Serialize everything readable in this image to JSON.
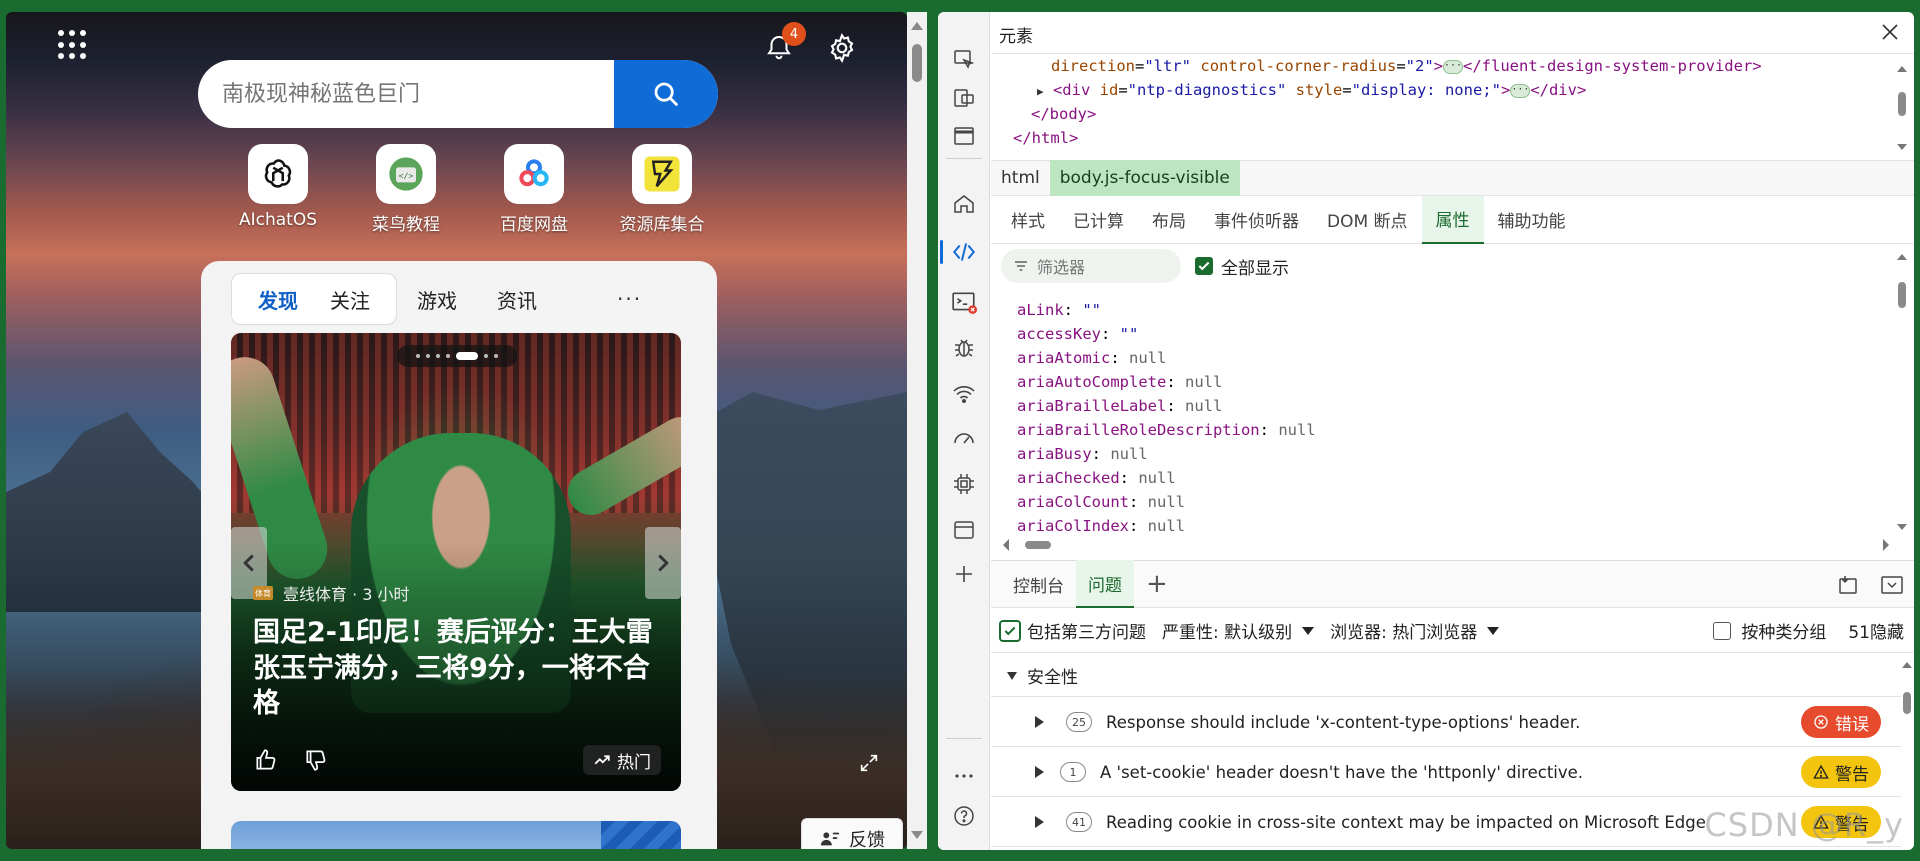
{
  "ntp": {
    "notification_count": "4",
    "search": {
      "placeholder": "南极现神秘蓝色巨门"
    },
    "quick_links": [
      {
        "label": "AIchatOS",
        "icon": "openai-icon"
      },
      {
        "label": "菜鸟教程",
        "icon": "runoob-icon"
      },
      {
        "label": "百度网盘",
        "icon": "baidu-pan-icon"
      },
      {
        "label": "资源库集合",
        "icon": "lightning-icon"
      }
    ],
    "feed_tabs": {
      "discover": "发现",
      "follow": "关注",
      "games": "游戏",
      "news": "资讯",
      "more": "···"
    },
    "hero": {
      "source": "壹线体育 · 3 小时",
      "source_logo": "体育",
      "title": "国足2-1印尼！赛后评分：王大雷张玉宁满分，三将9分，一将不合格",
      "hot_label": "热门"
    },
    "feedback_label": "反馈"
  },
  "devtools": {
    "title": "元素",
    "code_lines": {
      "line1_attr1": "direction",
      "line1_val1": "\"ltr\"",
      "line1_attr2": "control-corner-radius",
      "line1_val2": "\"2\"",
      "line1_close": "</fluent-design-system-provider>",
      "line2_open": "<div",
      "line2_attr1": "id",
      "line2_val1": "\"ntp-diagnostics\"",
      "line2_attr2": "style",
      "line2_val2": "\"display: none;\"",
      "line2_close": "</div>",
      "line3": "</body>",
      "line4": "</html>"
    },
    "breadcrumbs": [
      "html",
      "body.js-focus-visible"
    ],
    "sub_tabs": [
      "样式",
      "已计算",
      "布局",
      "事件侦听器",
      "DOM 断点",
      "属性",
      "辅助功能"
    ],
    "filter_placeholder": "筛选器",
    "show_all_label": "全部显示",
    "properties": [
      {
        "key": "aLink",
        "value": "\"\"",
        "kind": "s"
      },
      {
        "key": "accessKey",
        "value": "\"\"",
        "kind": "s"
      },
      {
        "key": "ariaAtomic",
        "value": "null",
        "kind": "n"
      },
      {
        "key": "ariaAutoComplete",
        "value": "null",
        "kind": "n"
      },
      {
        "key": "ariaBrailleLabel",
        "value": "null",
        "kind": "n"
      },
      {
        "key": "ariaBrailleRoleDescription",
        "value": "null",
        "kind": "n"
      },
      {
        "key": "ariaBusy",
        "value": "null",
        "kind": "n"
      },
      {
        "key": "ariaChecked",
        "value": "null",
        "kind": "n"
      },
      {
        "key": "ariaColCount",
        "value": "null",
        "kind": "n"
      },
      {
        "key": "ariaColIndex",
        "value": "null",
        "kind": "n"
      }
    ],
    "drawer_tabs": {
      "console": "控制台",
      "issues": "问题"
    },
    "issues_toolbar": {
      "third_party": "包括第三方问题",
      "severity": "严重性: 默认级别",
      "browser": "浏览器: 热门浏览器",
      "group_by_kind": "按种类分组",
      "hidden_count": "51隐藏"
    },
    "category": "安全性",
    "issues": [
      {
        "count": "25",
        "text": "Response should include 'x-content-type-options' header.",
        "severity": "错误",
        "level": "error"
      },
      {
        "count": "1",
        "text": "A 'set-cookie' header doesn't have the 'httponly' directive.",
        "severity": "警告",
        "level": "warning"
      },
      {
        "count": "41",
        "text": "Reading cookie in cross-site context may be impacted on Microsoft Edge",
        "severity": "警告",
        "level": "warning"
      }
    ]
  },
  "watermark": "CSDN @R_y",
  "colors": {
    "accent": "#0f6bd6",
    "devtools_green": "#1b6b2e",
    "error": "#e64b2e",
    "warning": "#f3c50f"
  }
}
